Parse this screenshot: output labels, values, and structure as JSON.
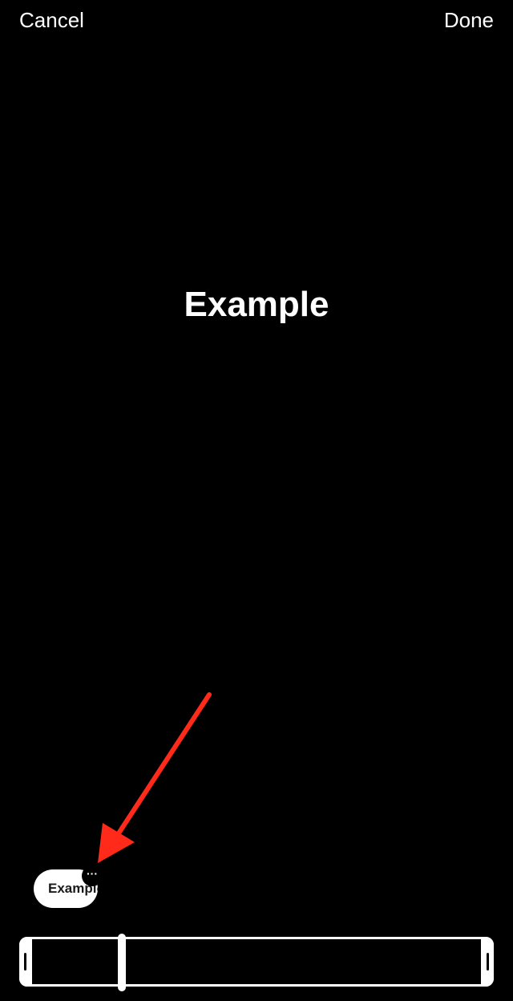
{
  "nav": {
    "cancel_label": "Cancel",
    "done_label": "Done"
  },
  "canvas": {
    "text": "Example"
  },
  "clip_chip": {
    "label": "Example",
    "more_icon": "ellipsis-icon",
    "more_glyph": "···"
  },
  "annotation": {
    "arrow_icon": "annotation-arrow-icon",
    "arrow_color": "#ff2a1a"
  },
  "timeline": {
    "playhead_position": 0.2
  },
  "colors": {
    "background": "#000000",
    "foreground": "#ffffff"
  }
}
